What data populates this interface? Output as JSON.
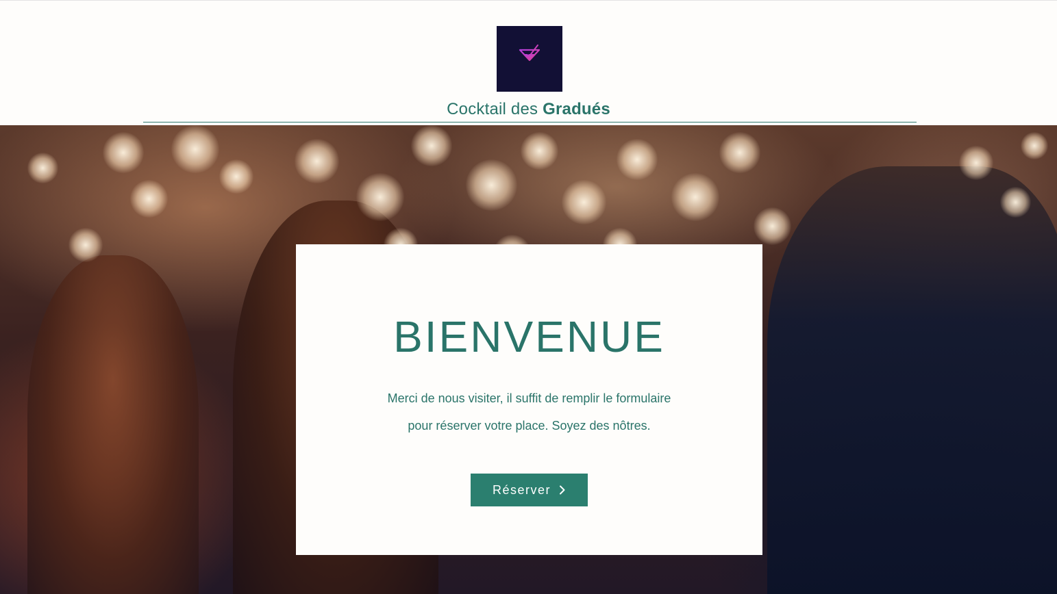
{
  "header": {
    "logo_icon": "cocktail-glass-icon",
    "logo_bg": "#121035",
    "title_light": "Cocktail des ",
    "title_bold": "Gradués"
  },
  "hero": {
    "background": "party-crowd-photo"
  },
  "card": {
    "heading": "BIENVENUE",
    "text_line1": "Merci de nous visiter, il suffit de remplir le formulaire",
    "text_line2": "pour réserver votre place. Soyez des nôtres.",
    "button_label": "Réserver",
    "button_icon": "chevron-right-icon"
  },
  "colors": {
    "accent": "#2a7469",
    "button": "#2b7f6f",
    "background": "#fefdfb"
  }
}
